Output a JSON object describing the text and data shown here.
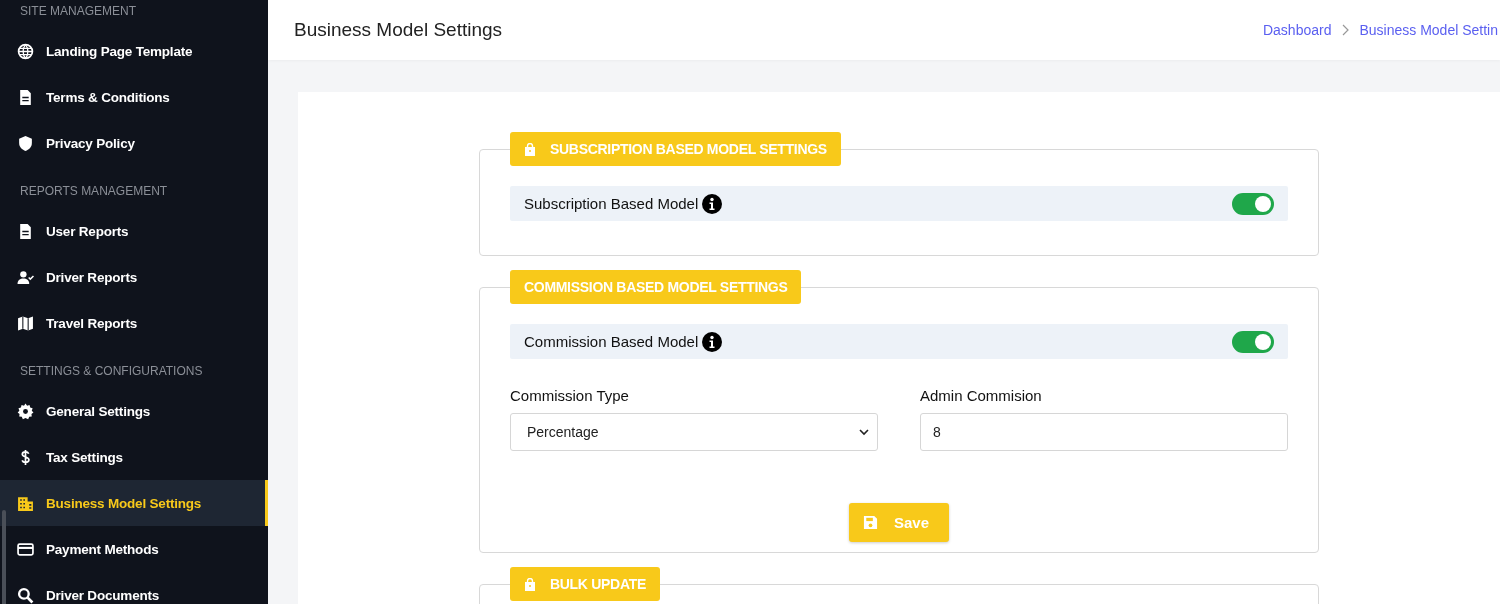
{
  "sidebar": {
    "groups": [
      {
        "heading": "SITE MANAGEMENT",
        "items": [
          {
            "label": "Landing Page Template",
            "selected": false
          },
          {
            "label": "Terms & Conditions",
            "selected": false
          },
          {
            "label": "Privacy Policy",
            "selected": false
          }
        ]
      },
      {
        "heading": "REPORTS MANAGEMENT",
        "items": [
          {
            "label": "User Reports",
            "selected": false
          },
          {
            "label": "Driver Reports",
            "selected": false
          },
          {
            "label": "Travel Reports",
            "selected": false
          }
        ]
      },
      {
        "heading": "SETTINGS & CONFIGURATIONS",
        "items": [
          {
            "label": "General Settings",
            "selected": false
          },
          {
            "label": "Tax Settings",
            "selected": false
          },
          {
            "label": "Business Model Settings",
            "selected": true
          },
          {
            "label": "Payment Methods",
            "selected": false
          },
          {
            "label": "Driver Documents",
            "selected": false
          }
        ]
      }
    ]
  },
  "header": {
    "title": "Business Model Settings",
    "breadcrumb": [
      "Dashboard",
      "Business Model Settin"
    ]
  },
  "sections": [
    {
      "title": "SUBSCRIPTION BASED MODEL SETTINGS",
      "toggle": {
        "label": "Subscription Based Model",
        "on": true
      }
    },
    {
      "title": "COMMISSION BASED MODEL SETTINGS",
      "toggle": {
        "label": "Commission Based Model",
        "on": true
      },
      "fields": [
        {
          "kind": "select",
          "label": "Commission Type",
          "value": "Percentage"
        },
        {
          "kind": "text",
          "label": "Admin Commision",
          "value": "8"
        }
      ],
      "button": "Save"
    },
    {
      "title": "BULK UPDATE"
    }
  ]
}
